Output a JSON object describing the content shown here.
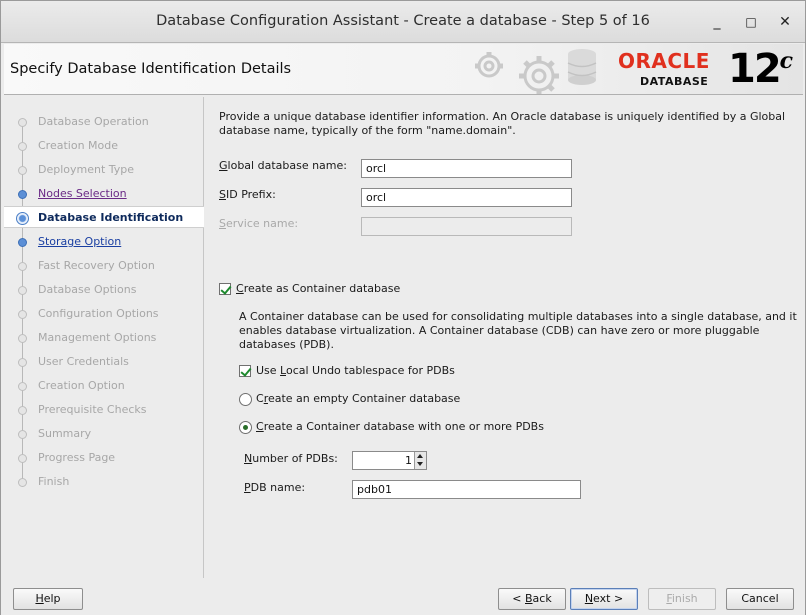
{
  "window": {
    "title": "Database Configuration Assistant - Create a database - Step 5 of 16",
    "minimize": "_",
    "maximize": "□",
    "close": "✕"
  },
  "header": {
    "title": "Specify Database Identification Details",
    "logo_oracle": "ORACLE",
    "logo_database": "DATABASE",
    "logo_version": "12",
    "logo_version_suffix": "c"
  },
  "sidebar": {
    "steps": [
      {
        "label": "Database Operation",
        "state": "disabled"
      },
      {
        "label": "Creation Mode",
        "state": "disabled"
      },
      {
        "label": "Deployment Type",
        "state": "disabled"
      },
      {
        "label": "Nodes Selection",
        "state": "visited"
      },
      {
        "label": "Database Identification",
        "state": "current"
      },
      {
        "label": "Storage Option",
        "state": "link"
      },
      {
        "label": "Fast Recovery Option",
        "state": "disabled"
      },
      {
        "label": "Database Options",
        "state": "disabled"
      },
      {
        "label": "Configuration Options",
        "state": "disabled"
      },
      {
        "label": "Management Options",
        "state": "disabled"
      },
      {
        "label": "User Credentials",
        "state": "disabled"
      },
      {
        "label": "Creation Option",
        "state": "disabled"
      },
      {
        "label": "Prerequisite Checks",
        "state": "disabled"
      },
      {
        "label": "Summary",
        "state": "disabled"
      },
      {
        "label": "Progress Page",
        "state": "disabled"
      },
      {
        "label": "Finish",
        "state": "disabled"
      }
    ]
  },
  "main": {
    "description": "Provide a unique database identifier information. An Oracle database is uniquely identified by a Global database name, typically of the form \"name.domain\".",
    "global_db_name": {
      "label_mn": "G",
      "label_rest": "lobal database name:",
      "value": "orcl"
    },
    "sid_prefix": {
      "label_mn": "S",
      "label_rest": "ID Prefix:",
      "value": "orcl"
    },
    "service_name": {
      "label_mn": "S",
      "label_rest": "ervice name:",
      "value": ""
    },
    "container": {
      "checkbox_mn": "C",
      "checkbox_rest": "reate as Container database",
      "checked": true,
      "description": "A Container database can be used for consolidating multiple databases into a single database, and it enables database virtualization. A Container database (CDB) can have zero or more pluggable databases (PDB).",
      "local_undo_pre": "Use ",
      "local_undo_mn": "L",
      "local_undo_rest": "ocal Undo tablespace for PDBs",
      "local_undo_checked": true,
      "empty_cdb_pre": "C",
      "empty_cdb_mn": "r",
      "empty_cdb_rest": "eate an empty Container database",
      "with_pdbs_mn": "C",
      "with_pdbs_rest": "reate a Container database with one or more PDBs",
      "selected_option": "with_pdbs",
      "num_pdbs_mn": "N",
      "num_pdbs_rest": "umber of PDBs:",
      "num_pdbs_value": "1",
      "pdb_name_mn": "P",
      "pdb_name_rest": "DB name:",
      "pdb_name_value": "pdb01"
    }
  },
  "footer": {
    "help_mn": "H",
    "help_rest": "elp",
    "back_pre": "< ",
    "back_mn": "B",
    "back_rest": "ack",
    "next_mn": "N",
    "next_rest": "ext >",
    "finish_mn": "F",
    "finish_rest": "inish",
    "cancel": "Cancel"
  },
  "colors": {
    "accent": "#e0301e",
    "link": "#1a3fa2",
    "visited": "#6a2a86"
  }
}
